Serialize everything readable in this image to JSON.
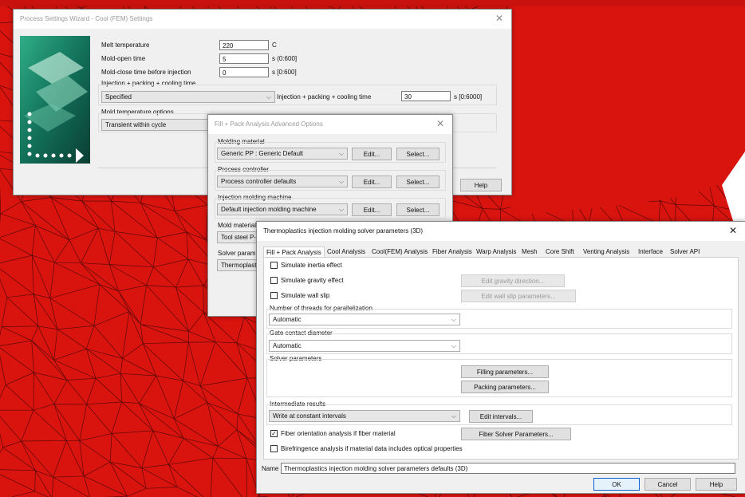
{
  "process_wizard": {
    "title": "Process Settings Wizard - Cool (FEM) Settings",
    "melt_temp_label": "Melt temperature",
    "melt_temp_value": "220",
    "melt_temp_unit": "C",
    "mold_open_label": "Mold-open time",
    "mold_open_value": "5",
    "mold_open_unit": "s (0:600]",
    "mold_close_label": "Mold-close time before injection",
    "mold_close_value": "0",
    "mold_close_unit": "s [0:600]",
    "ipc_group_label": "Injection + packing + cooling time",
    "ipc_select": "Specified",
    "ipc_field_label": "Injection + packing + cooling time",
    "ipc_value": "30",
    "ipc_unit": "s [0:6000]",
    "mold_temp_group_label": "Mold temperature options",
    "mold_temp_select": "Transient within cycle",
    "help_label": "Help"
  },
  "fill_pack_dialog": {
    "title": "Fill + Pack Analysis Advanced Options",
    "molding_material_label": "Molding material",
    "molding_material_value": "Generic PP : Generic Default",
    "process_controller_label": "Process controller",
    "process_controller_value": "Process controller defaults",
    "machine_label": "Injection molding machine",
    "machine_value": "Default injection molding machine",
    "mold_material_label": "Mold material",
    "mold_material_value": "Tool steel P-",
    "solver_label": "Solver parame",
    "solver_value": "Thermoplastic",
    "edit_label": "Edit...",
    "select_label": "Select..."
  },
  "solver_dialog": {
    "title": "Thermoplastics injection molding solver parameters (3D)",
    "tabs": [
      "Fill + Pack Analysis",
      "Cool Analysis",
      "Cool(FEM) Analysis",
      "Fiber Analysis",
      "Warp Analysis",
      "Mesh",
      "Core Shift",
      "Venting Analysis",
      "Interface",
      "Solver API"
    ],
    "simulate_inertia": "Simulate inertia effect",
    "simulate_gravity": "Simulate gravity effect",
    "edit_gravity": "Edit gravity direction...",
    "simulate_wall_slip": "Simulate wall slip",
    "edit_wall_slip": "Edit wall slip parameters...",
    "threads_label": "Number of threads for parallelization",
    "threads_value": "Automatic",
    "gate_label": "Gate contact diameter",
    "gate_value": "Automatic",
    "solver_params_label": "Solver parameters",
    "filling_params": "Filling parameters...",
    "packing_params": "Packing parameters...",
    "intermediate_label": "Intermediate results",
    "intermediate_value": "Write at constant intervals",
    "edit_intervals": "Edit intervals...",
    "fiber_orientation": "Fiber orientation analysis if fiber material",
    "fiber_solver_params": "Fiber Solver Parameters...",
    "birefringence": "Birefringence analysis if material data includes optical properties",
    "name_label": "Name",
    "name_value": "Thermoplastics injection molding solver parameters defaults (3D)",
    "ok": "OK",
    "cancel": "Cancel",
    "help": "Help"
  },
  "colors": {
    "mesh_red": "#d9140f",
    "mesh_line": "#6a0a08"
  }
}
